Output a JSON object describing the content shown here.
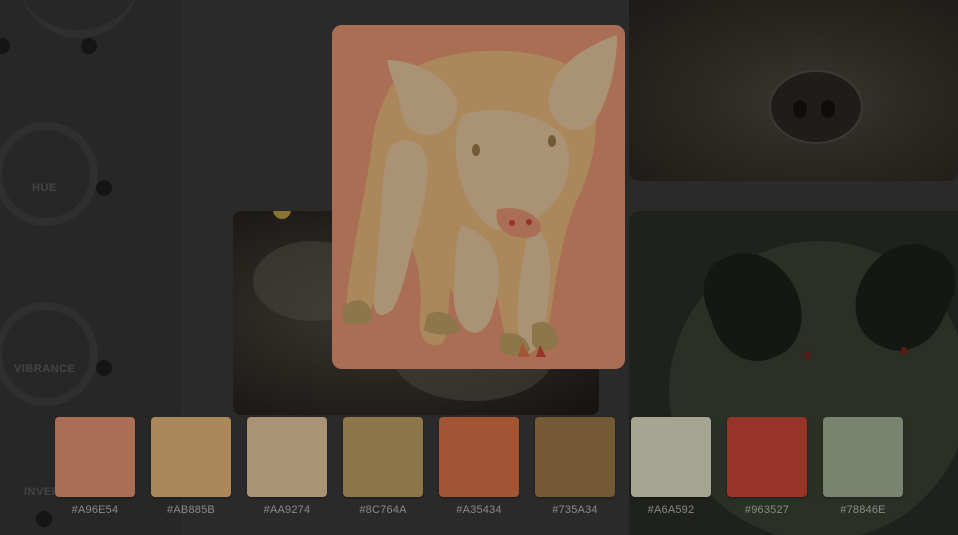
{
  "controls": {
    "dials": [
      {
        "label": "HUE"
      },
      {
        "label": "VIBRANCE"
      },
      {
        "label": "INVERT"
      }
    ]
  },
  "palette": [
    {
      "hex": "#A96E54",
      "color": "#A96E54"
    },
    {
      "hex": "#AB885B",
      "color": "#AB885B"
    },
    {
      "hex": "#AA9274",
      "color": "#AA9274"
    },
    {
      "hex": "#8C764A",
      "color": "#8C764A"
    },
    {
      "hex": "#A35434",
      "color": "#A35434"
    },
    {
      "hex": "#735A34",
      "color": "#735A34"
    },
    {
      "hex": "#A6A592",
      "color": "#A6A592"
    },
    {
      "hex": "#963527",
      "color": "#963527"
    },
    {
      "hex": "#78846E",
      "color": "#78846E"
    }
  ],
  "feature": {
    "subject": "piglet-photo"
  }
}
